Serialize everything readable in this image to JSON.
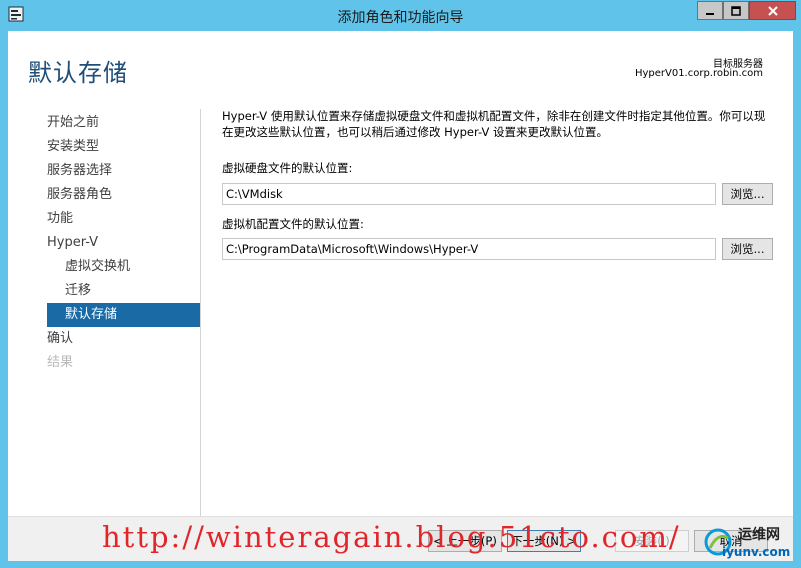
{
  "window": {
    "title": "添加角色和功能向导"
  },
  "header": {
    "page_title": "默认存储",
    "dest_label": "目标服务器",
    "dest_server": "HyperV01.corp.robin.com"
  },
  "nav": {
    "items": [
      {
        "label": "开始之前",
        "state": "normal"
      },
      {
        "label": "安装类型",
        "state": "normal"
      },
      {
        "label": "服务器选择",
        "state": "normal"
      },
      {
        "label": "服务器角色",
        "state": "normal"
      },
      {
        "label": "功能",
        "state": "normal"
      },
      {
        "label": "Hyper-V",
        "state": "normal"
      },
      {
        "label": "虚拟交换机",
        "state": "sub"
      },
      {
        "label": "迁移",
        "state": "sub"
      },
      {
        "label": "默认存储",
        "state": "active"
      },
      {
        "label": "确认",
        "state": "normal"
      },
      {
        "label": "结果",
        "state": "disabled"
      }
    ]
  },
  "content": {
    "description": "Hyper-V 使用默认位置来存储虚拟硬盘文件和虚拟机配置文件，除非在创建文件时指定其他位置。你可以现在更改这些默认位置，也可以稍后通过修改 Hyper-V 设置来更改默认位置。",
    "vhd_label": "虚拟硬盘文件的默认位置:",
    "vhd_value": "C:\\VMdisk",
    "config_label": "虚拟机配置文件的默认位置:",
    "config_value": "C:\\ProgramData\\Microsoft\\Windows\\Hyper-V",
    "browse_label": "浏览..."
  },
  "footer": {
    "prev_label": "< 上一步(P)",
    "next_label": "下一步(N) >",
    "install_label": "安装(I)",
    "cancel_label": "取消"
  },
  "overlay": {
    "watermark": "http://winteragain.blog.51cto.com/",
    "logo_text": "运维网",
    "logo_sub": "iyunv.com"
  },
  "colors": {
    "title_bar": "#5fc3ea",
    "accent": "#1a6aa5",
    "heading": "#1e4e79",
    "close_button": "#c75050",
    "watermark": "#e0262b"
  },
  "icons": {
    "app": "server-manager-icon",
    "minimize": "minimize-icon",
    "maximize": "maximize-icon",
    "close": "close-icon"
  }
}
